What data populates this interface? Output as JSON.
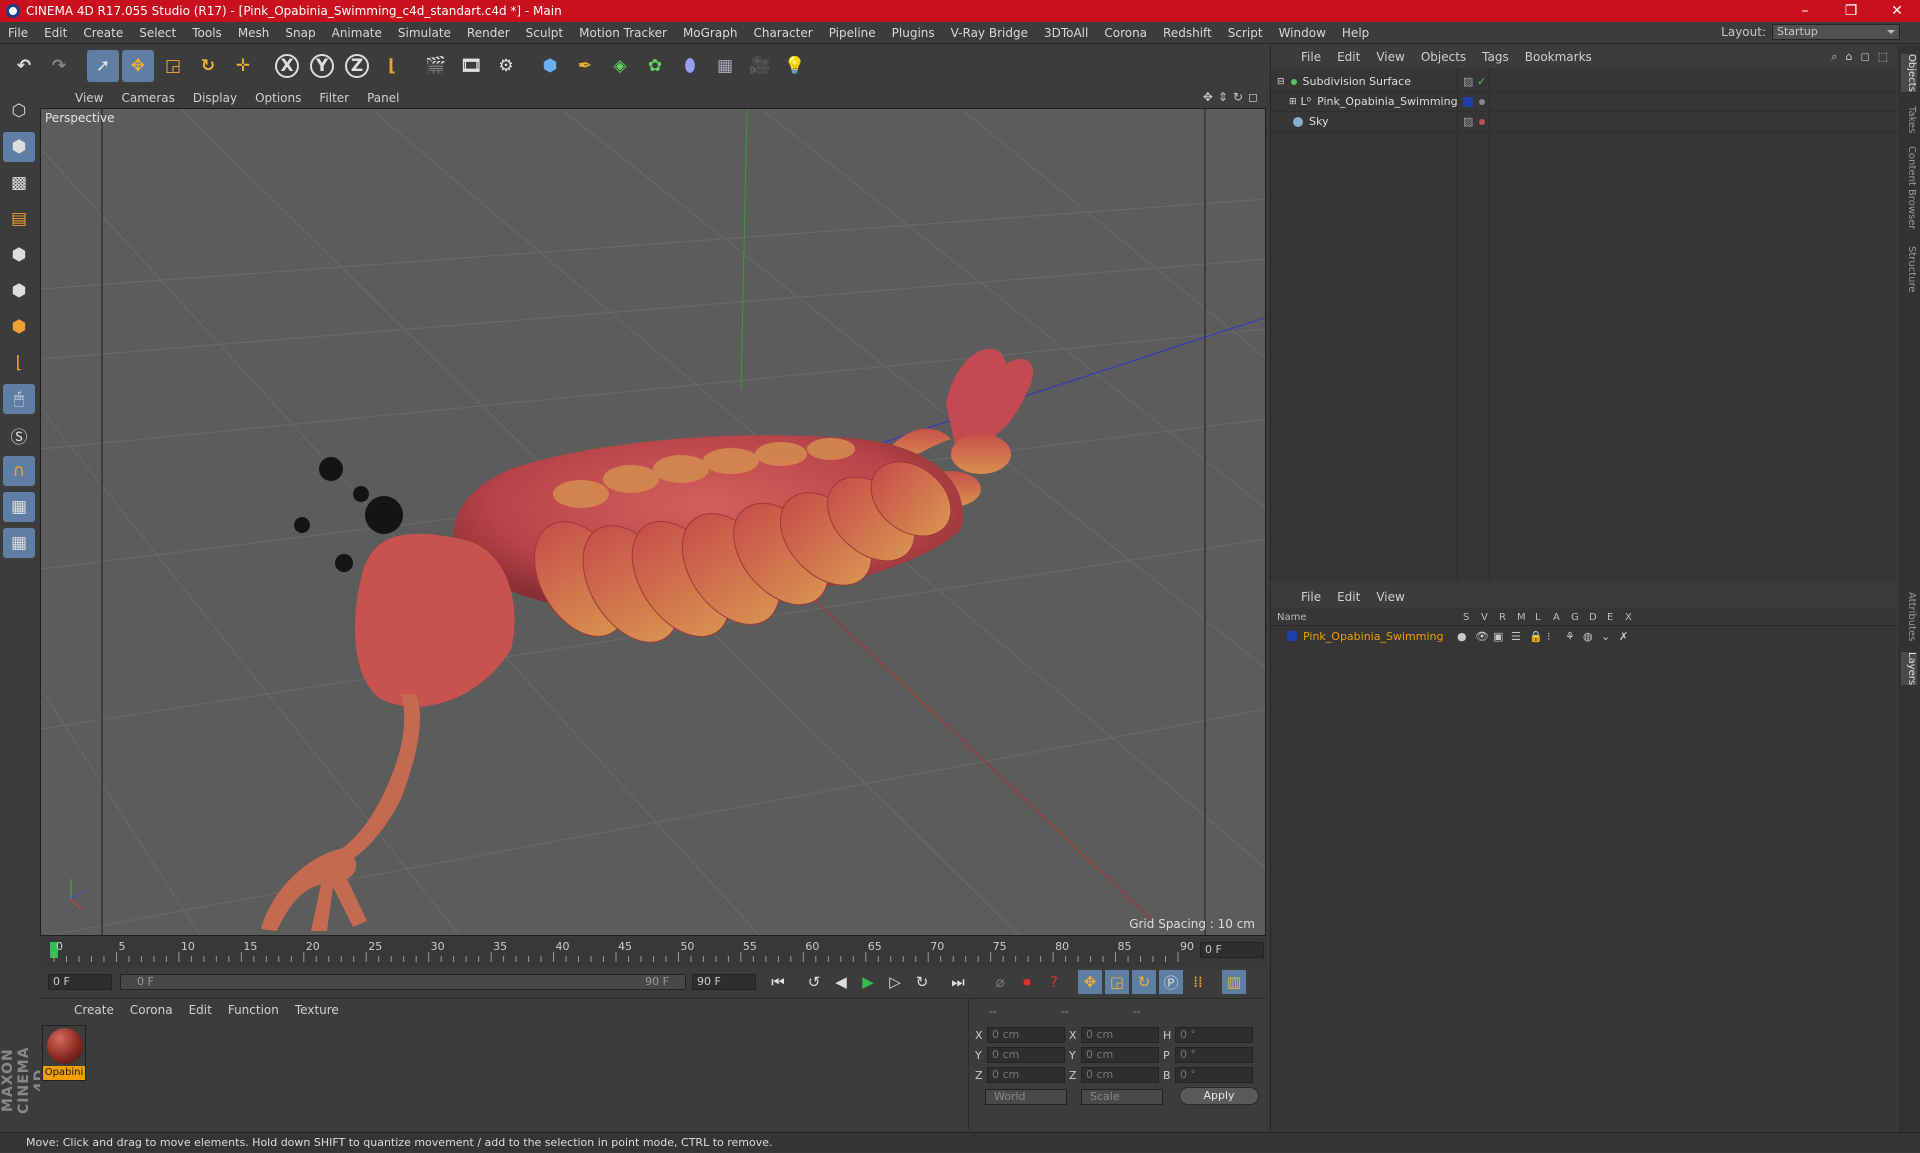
{
  "window": {
    "title": "CINEMA 4D R17.055 Studio (R17) - [Pink_Opabinia_Swimming_c4d_standart.c4d *] - Main",
    "controls": [
      "–",
      "❐",
      "✕"
    ]
  },
  "menubar": {
    "items": [
      "File",
      "Edit",
      "Create",
      "Select",
      "Tools",
      "Mesh",
      "Snap",
      "Animate",
      "Simulate",
      "Render",
      "Sculpt",
      "Motion Tracker",
      "MoGraph",
      "Character",
      "Pipeline",
      "Plugins",
      "V-Ray Bridge",
      "3DToAll",
      "Corona",
      "Redshift",
      "Script",
      "Window",
      "Help"
    ],
    "layout_label": "Layout:",
    "layout_value": "Startup"
  },
  "toolbar": {
    "icons": [
      "undo-icon",
      "redo-icon",
      "select-arrow-icon",
      "move-icon",
      "scale-icon",
      "rotate-icon",
      "live-select-icon",
      "x-axis-icon",
      "y-axis-icon",
      "z-axis-icon",
      "coordinate-system-icon",
      "render-view-icon",
      "render-picture-viewer-icon",
      "render-settings-icon",
      "cube-icon",
      "pen-spline-icon",
      "subdivision-icon",
      "mograph-cloner-icon",
      "deformer-icon",
      "floor-icon",
      "camera-icon",
      "light-icon"
    ],
    "axis_labels": [
      "X",
      "Y",
      "Z"
    ]
  },
  "viewport": {
    "menu": [
      "View",
      "Cameras",
      "Display",
      "Options",
      "Filter",
      "Panel"
    ],
    "label": "Perspective",
    "grid_spacing": "Grid Spacing : 10 cm"
  },
  "timeline": {
    "ticks": [
      "0",
      "5",
      "10",
      "15",
      "20",
      "25",
      "30",
      "35",
      "40",
      "45",
      "50",
      "55",
      "60",
      "65",
      "70",
      "75",
      "80",
      "85",
      "90"
    ],
    "current_frame": "0 F"
  },
  "transport": {
    "start_field": "0 F",
    "slider_start": "0 F",
    "slider_end": "90 F",
    "end_field": "90 F"
  },
  "material_panel": {
    "menu": [
      "Create",
      "Corona",
      "Edit",
      "Function",
      "Texture"
    ],
    "material_name": "Opabini"
  },
  "coordinates": {
    "header": [
      "--",
      "--",
      "--"
    ],
    "rows": [
      {
        "a": "X",
        "v1": "0 cm",
        "b": "X",
        "v2": "0 cm",
        "c": "H",
        "v3": "0 °"
      },
      {
        "a": "Y",
        "v1": "0 cm",
        "b": "Y",
        "v2": "0 cm",
        "c": "P",
        "v3": "0 °"
      },
      {
        "a": "Z",
        "v1": "0 cm",
        "b": "Z",
        "v2": "0 cm",
        "c": "B",
        "v3": "0 °"
      }
    ],
    "world": "World",
    "scale": "Scale",
    "apply": "Apply"
  },
  "object_manager": {
    "menu": [
      "File",
      "Edit",
      "View",
      "Objects",
      "Tags",
      "Bookmarks"
    ],
    "objects": [
      {
        "name": "Subdivision Surface",
        "color": "#60c060"
      },
      {
        "name": "Pink_Opabinia_Swimming",
        "color": "#1f3faa"
      },
      {
        "name": "Sky",
        "color": "#c05050"
      }
    ]
  },
  "layer_manager": {
    "menu": [
      "File",
      "Edit",
      "View"
    ],
    "columns": [
      "Name",
      "S",
      "V",
      "R",
      "M",
      "L",
      "A",
      "G",
      "D",
      "E",
      "X"
    ],
    "layer_name": "Pink_Opabinia_Swimming",
    "layer_color": "#f0a000"
  },
  "side_tabs": [
    "Objects",
    "Takes",
    "Content Browser",
    "Structure",
    "Attributes",
    "Layers"
  ],
  "status": "Move: Click and drag to move elements. Hold down SHIFT to quantize movement / add to the selection in point mode, CTRL to remove.",
  "branding": "MAXON CINEMA 4D"
}
